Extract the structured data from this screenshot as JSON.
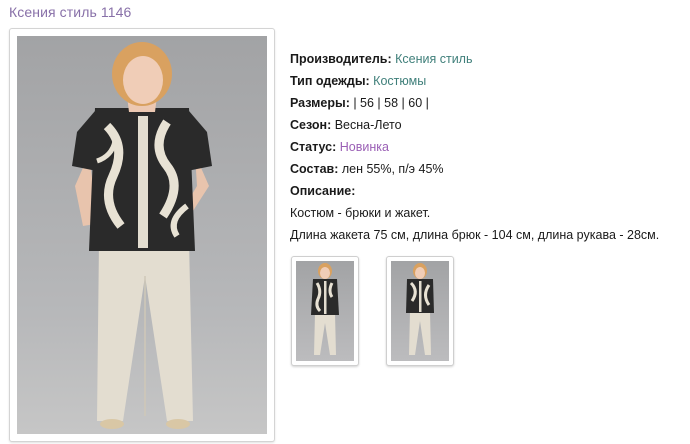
{
  "page": {
    "title": "Ксения стиль 1146"
  },
  "product": {
    "manufacturer_label": "Производитель:",
    "manufacturer_value": "Ксения стиль",
    "type_label": "Тип одежды:",
    "type_value": "Костюмы",
    "sizes_label": "Размеры:",
    "sizes_value": "| 56 | 58 | 60 |",
    "season_label": "Сезон:",
    "season_value": "Весна-Лето",
    "status_label": "Статус:",
    "status_value": "Новинка",
    "composition_label": "Состав:",
    "composition_value": "лен 55%, п/э 45%",
    "description_label": "Описание:",
    "description_line1": "Костюм - брюки и жакет.",
    "description_line2": "Длина жакета 75 см, длина брюк - 104 см, длина рукава - 28см."
  },
  "colors": {
    "title": "#8870a8",
    "link_green": "#3f7f7a",
    "link_purple": "#9a5fb5"
  }
}
